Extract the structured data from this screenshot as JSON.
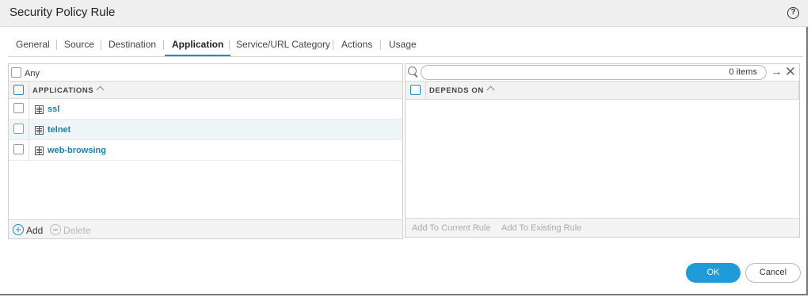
{
  "dialog": {
    "title": "Security Policy Rule"
  },
  "tabs": [
    {
      "label": "General"
    },
    {
      "label": "Source"
    },
    {
      "label": "Destination"
    },
    {
      "label": "Application"
    },
    {
      "label": "Service/URL Category"
    },
    {
      "label": "Actions"
    },
    {
      "label": "Usage"
    }
  ],
  "active_tab": "Application",
  "applications_panel": {
    "any_label": "Any",
    "any_checked": false,
    "column_header": "APPLICATIONS",
    "rows": [
      {
        "name": "ssl",
        "checked": false
      },
      {
        "name": "telnet",
        "checked": false
      },
      {
        "name": "web-browsing",
        "checked": false
      }
    ],
    "add_label": "Add",
    "delete_label": "Delete"
  },
  "depends_panel": {
    "search_value": "",
    "items_count": "0 items",
    "column_header": "DEPENDS ON",
    "add_current_label": "Add To Current Rule",
    "add_existing_label": "Add To Existing Rule"
  },
  "footer": {
    "ok_label": "OK",
    "cancel_label": "Cancel"
  },
  "colors": {
    "accent": "#1f9bd7",
    "link": "#1a7fae"
  }
}
